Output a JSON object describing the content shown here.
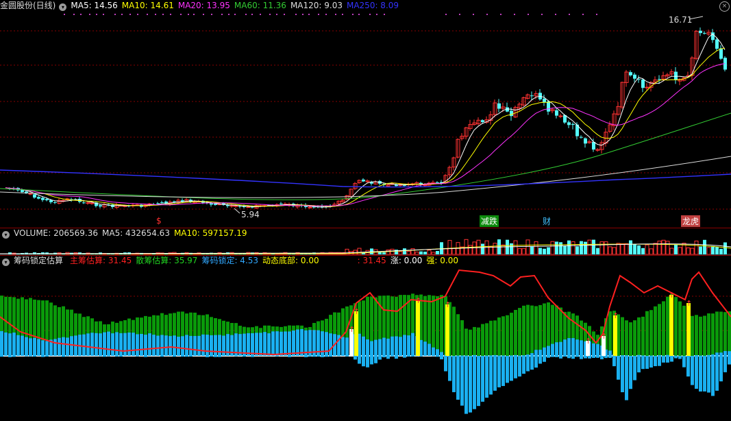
{
  "title": "金圆股份(日线)",
  "main_legend": [
    {
      "label": "MA5: 14.56",
      "color": "#ffffff"
    },
    {
      "label": "MA10: 14.61",
      "color": "#ffff00"
    },
    {
      "label": "MA20: 13.95",
      "color": "#ff33ff"
    },
    {
      "label": "MA60: 11.36",
      "color": "#33cc33"
    },
    {
      "label": "MA120: 9.03",
      "color": "#dddddd"
    },
    {
      "label": "MA250: 8.09",
      "color": "#3333ff"
    }
  ],
  "high_label": "16.71",
  "low_label": "5.94",
  "markers": [
    {
      "text": "$",
      "color": "#ff3030",
      "bg": "none"
    },
    {
      "text": "减跌",
      "color": "#ffffff",
      "bg": "#0c8a0c"
    },
    {
      "text": "财",
      "color": "#40c0ff",
      "bg": "none"
    },
    {
      "text": "龙虎",
      "color": "#ffffff",
      "bg": "#c04040"
    }
  ],
  "volume_legend": [
    {
      "label": "VOLUME: 206569.36",
      "color": "#dddddd"
    },
    {
      "label": "MA5: 432654.63",
      "color": "#dddddd"
    },
    {
      "label": "MA10: 597157.19",
      "color": "#ffff00"
    }
  ],
  "indicator_title": "筹码锁定估算",
  "indicator_legend": [
    {
      "label": "主筹估算: 31.45",
      "color": "#ff2020"
    },
    {
      "label": "散筹估算: 35.97",
      "color": "#20d020"
    },
    {
      "label": "筹码锁定: 4.53",
      "color": "#30a8ff"
    },
    {
      "label": "动态底部: 0.00",
      "color": "#ffff00"
    },
    {
      "label": ": 31.45",
      "color": "#ff2020"
    },
    {
      "label": "涨: 0.00",
      "color": "#ffffff"
    },
    {
      "label": "强: 0.00",
      "color": "#ffff00"
    }
  ],
  "colors": {
    "up": "#ff3232",
    "down": "#54fcfc",
    "grid": "#8a0000",
    "green": "#0a9a0a",
    "blue": "#1ab0f0",
    "yellow": "#ffff00"
  },
  "close_icon": "close-icon"
}
